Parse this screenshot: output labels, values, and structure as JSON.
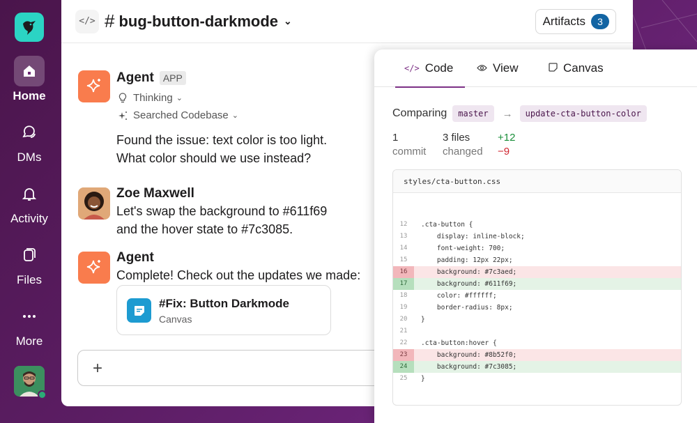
{
  "sidebar": {
    "items": [
      {
        "label": "Home",
        "icon": "home-icon",
        "active": true
      },
      {
        "label": "DMs",
        "icon": "dms-icon",
        "active": false
      },
      {
        "label": "Activity",
        "icon": "bell-icon",
        "active": false
      },
      {
        "label": "Files",
        "icon": "files-icon",
        "active": false
      },
      {
        "label": "More",
        "icon": "more-icon",
        "active": false
      }
    ]
  },
  "header": {
    "channel": "bug-button-darkmode",
    "artifacts_label": "Artifacts",
    "artifacts_count": "3"
  },
  "messages": [
    {
      "name": "Agent",
      "tag": "APP",
      "steps": [
        "Thinking",
        "Searched Codebase"
      ],
      "lines": [
        "Found the issue: text color is too light.",
        "What color should we use instead?"
      ]
    },
    {
      "name": "Zoe Maxwell",
      "lines": [
        "Let's swap the background to #611f69",
        "and the hover state to #7c3085."
      ]
    },
    {
      "name": "Agent",
      "lines": [
        "Complete! Check out the updates we made:"
      ],
      "card": {
        "title": "#Fix: Button Darkmode",
        "subtitle": "Canvas"
      }
    }
  ],
  "panel": {
    "tabs": [
      {
        "label": "Code",
        "icon": "</>",
        "active": true
      },
      {
        "label": "View",
        "icon": "◉",
        "active": false
      },
      {
        "label": "Canvas",
        "icon": "▢",
        "active": false
      }
    ],
    "comparing_label": "Comparing",
    "base_branch": "master",
    "head_branch": "update-cta-button-color",
    "commits": {
      "value": "1",
      "label": "commit"
    },
    "files": {
      "value": "3 files",
      "label": "changed"
    },
    "additions": "+12",
    "deletions": "−9",
    "file_name": "styles/cta-button.css",
    "code": [
      {
        "n": "12",
        "text": ".cta-button {",
        "type": "ctx"
      },
      {
        "n": "13",
        "text": "    display: inline-block;",
        "type": "ctx"
      },
      {
        "n": "14",
        "text": "    font-weight: 700;",
        "type": "ctx"
      },
      {
        "n": "15",
        "text": "    padding: 12px 22px;",
        "type": "ctx"
      },
      {
        "n": "16",
        "text": "    background: #7c3aed;",
        "type": "del"
      },
      {
        "n": "17",
        "text": "    background: #611f69;",
        "type": "add"
      },
      {
        "n": "18",
        "text": "    color: #ffffff;",
        "type": "ctx"
      },
      {
        "n": "19",
        "text": "    border-radius: 8px;",
        "type": "ctx"
      },
      {
        "n": "20",
        "text": "}",
        "type": "ctx"
      },
      {
        "n": "21",
        "text": "",
        "type": "ctx"
      },
      {
        "n": "22",
        "text": ".cta-button:hover {",
        "type": "ctx"
      },
      {
        "n": "23",
        "text": "    background: #8b52f0;",
        "type": "del"
      },
      {
        "n": "24",
        "text": "    background: #7c3085;",
        "type": "add"
      },
      {
        "n": "25",
        "text": "}",
        "type": "ctx"
      }
    ]
  },
  "colors": {
    "brand": "#4a154b",
    "accent": "#7c3085",
    "badge": "#1264a3",
    "agent": "#f97c4d"
  }
}
